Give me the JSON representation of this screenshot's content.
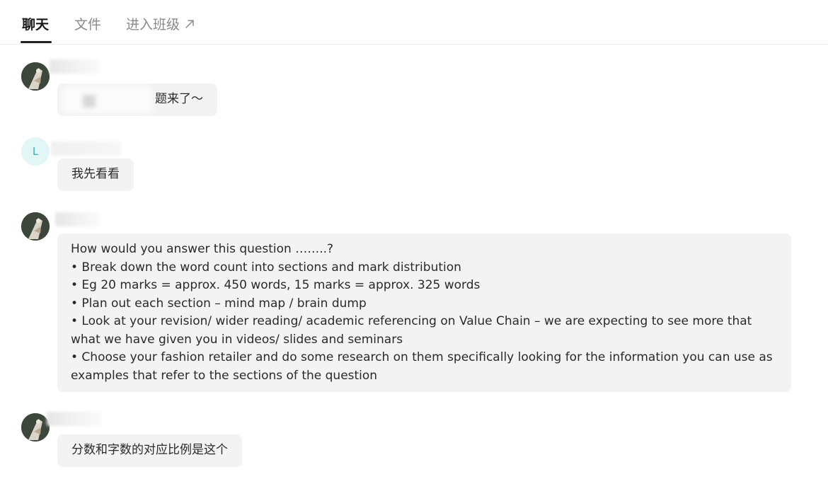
{
  "tabs": [
    {
      "label": "聊天",
      "active": true
    },
    {
      "label": "文件",
      "active": false
    },
    {
      "label": "进入班级",
      "active": false,
      "icon": "arrow-up-right-icon"
    }
  ],
  "messages": [
    {
      "avatar": "avatar-photo",
      "text": "题来了～"
    },
    {
      "avatar": "L",
      "text": "我先看看"
    },
    {
      "avatar": "avatar-photo",
      "text": "How would you answer this question ……..?\n• Break down the word count into sections and mark distribution\n• Eg 20 marks = approx. 450 words, 15 marks = approx. 325 words\n• Plan out each section – mind map / brain dump\n• Look at your revision/ wider reading/ academic referencing on Value Chain – we are expecting to see more that what we have given you in videos/ slides and seminars\n• Choose your fashion retailer and do some research on them specifically looking for the information you can use as examples that refer to the sections of the question"
    },
    {
      "avatar": "avatar-photo",
      "text": "分数和字数的对应比例是这个"
    }
  ],
  "colors": {
    "bubble": "#f3f3f3",
    "active_tab": "#1a1a1a",
    "inactive_tab": "#8a8a8a",
    "avatar_L": "#39b3b7"
  }
}
